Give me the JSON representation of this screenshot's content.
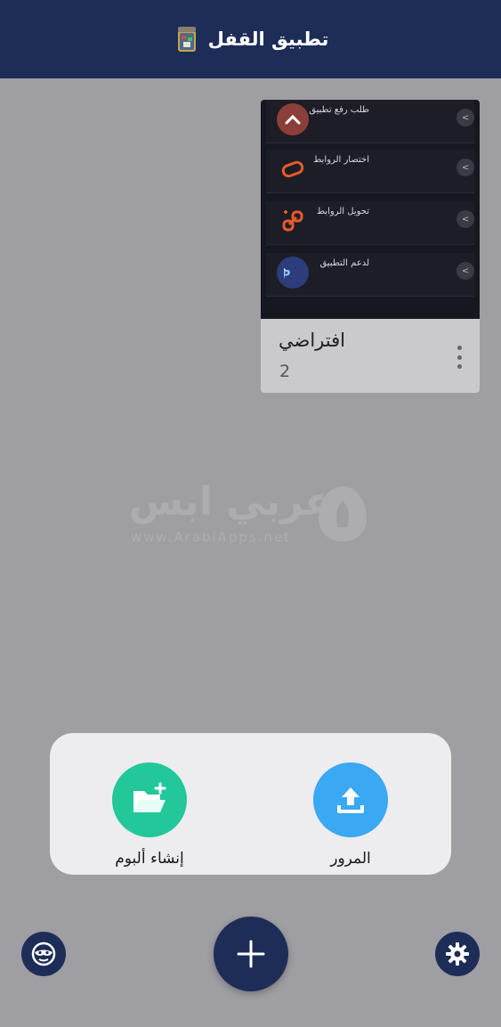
{
  "app": {
    "title": "تطبيق القفل",
    "logo_icon": "lock-app-logo-icon"
  },
  "album": {
    "name": "افتراضي",
    "count": "2",
    "thumbnail_rows": [
      {
        "label": "طلب رفع تطبيق",
        "icon": "chevron-up-icon"
      },
      {
        "label": "اختصار الروابط",
        "icon": "link-shorten-icon"
      },
      {
        "label": "تحويل الروابط",
        "icon": "link-convert-icon"
      },
      {
        "label": "لدعم التطبيق",
        "icon": "paypal-icon"
      }
    ],
    "menu_icon": "more-vertical-icon"
  },
  "watermark": {
    "text": "عربي ابس",
    "url": "www.ArabiApps.net"
  },
  "sheet": {
    "create_album_label": "إنشاء ألبوم",
    "browse_label": "المرور"
  },
  "colors": {
    "header": "#1e2d57",
    "background": "#9e9ea3",
    "create_album": "#22c79a",
    "browse": "#3aa8f2"
  }
}
